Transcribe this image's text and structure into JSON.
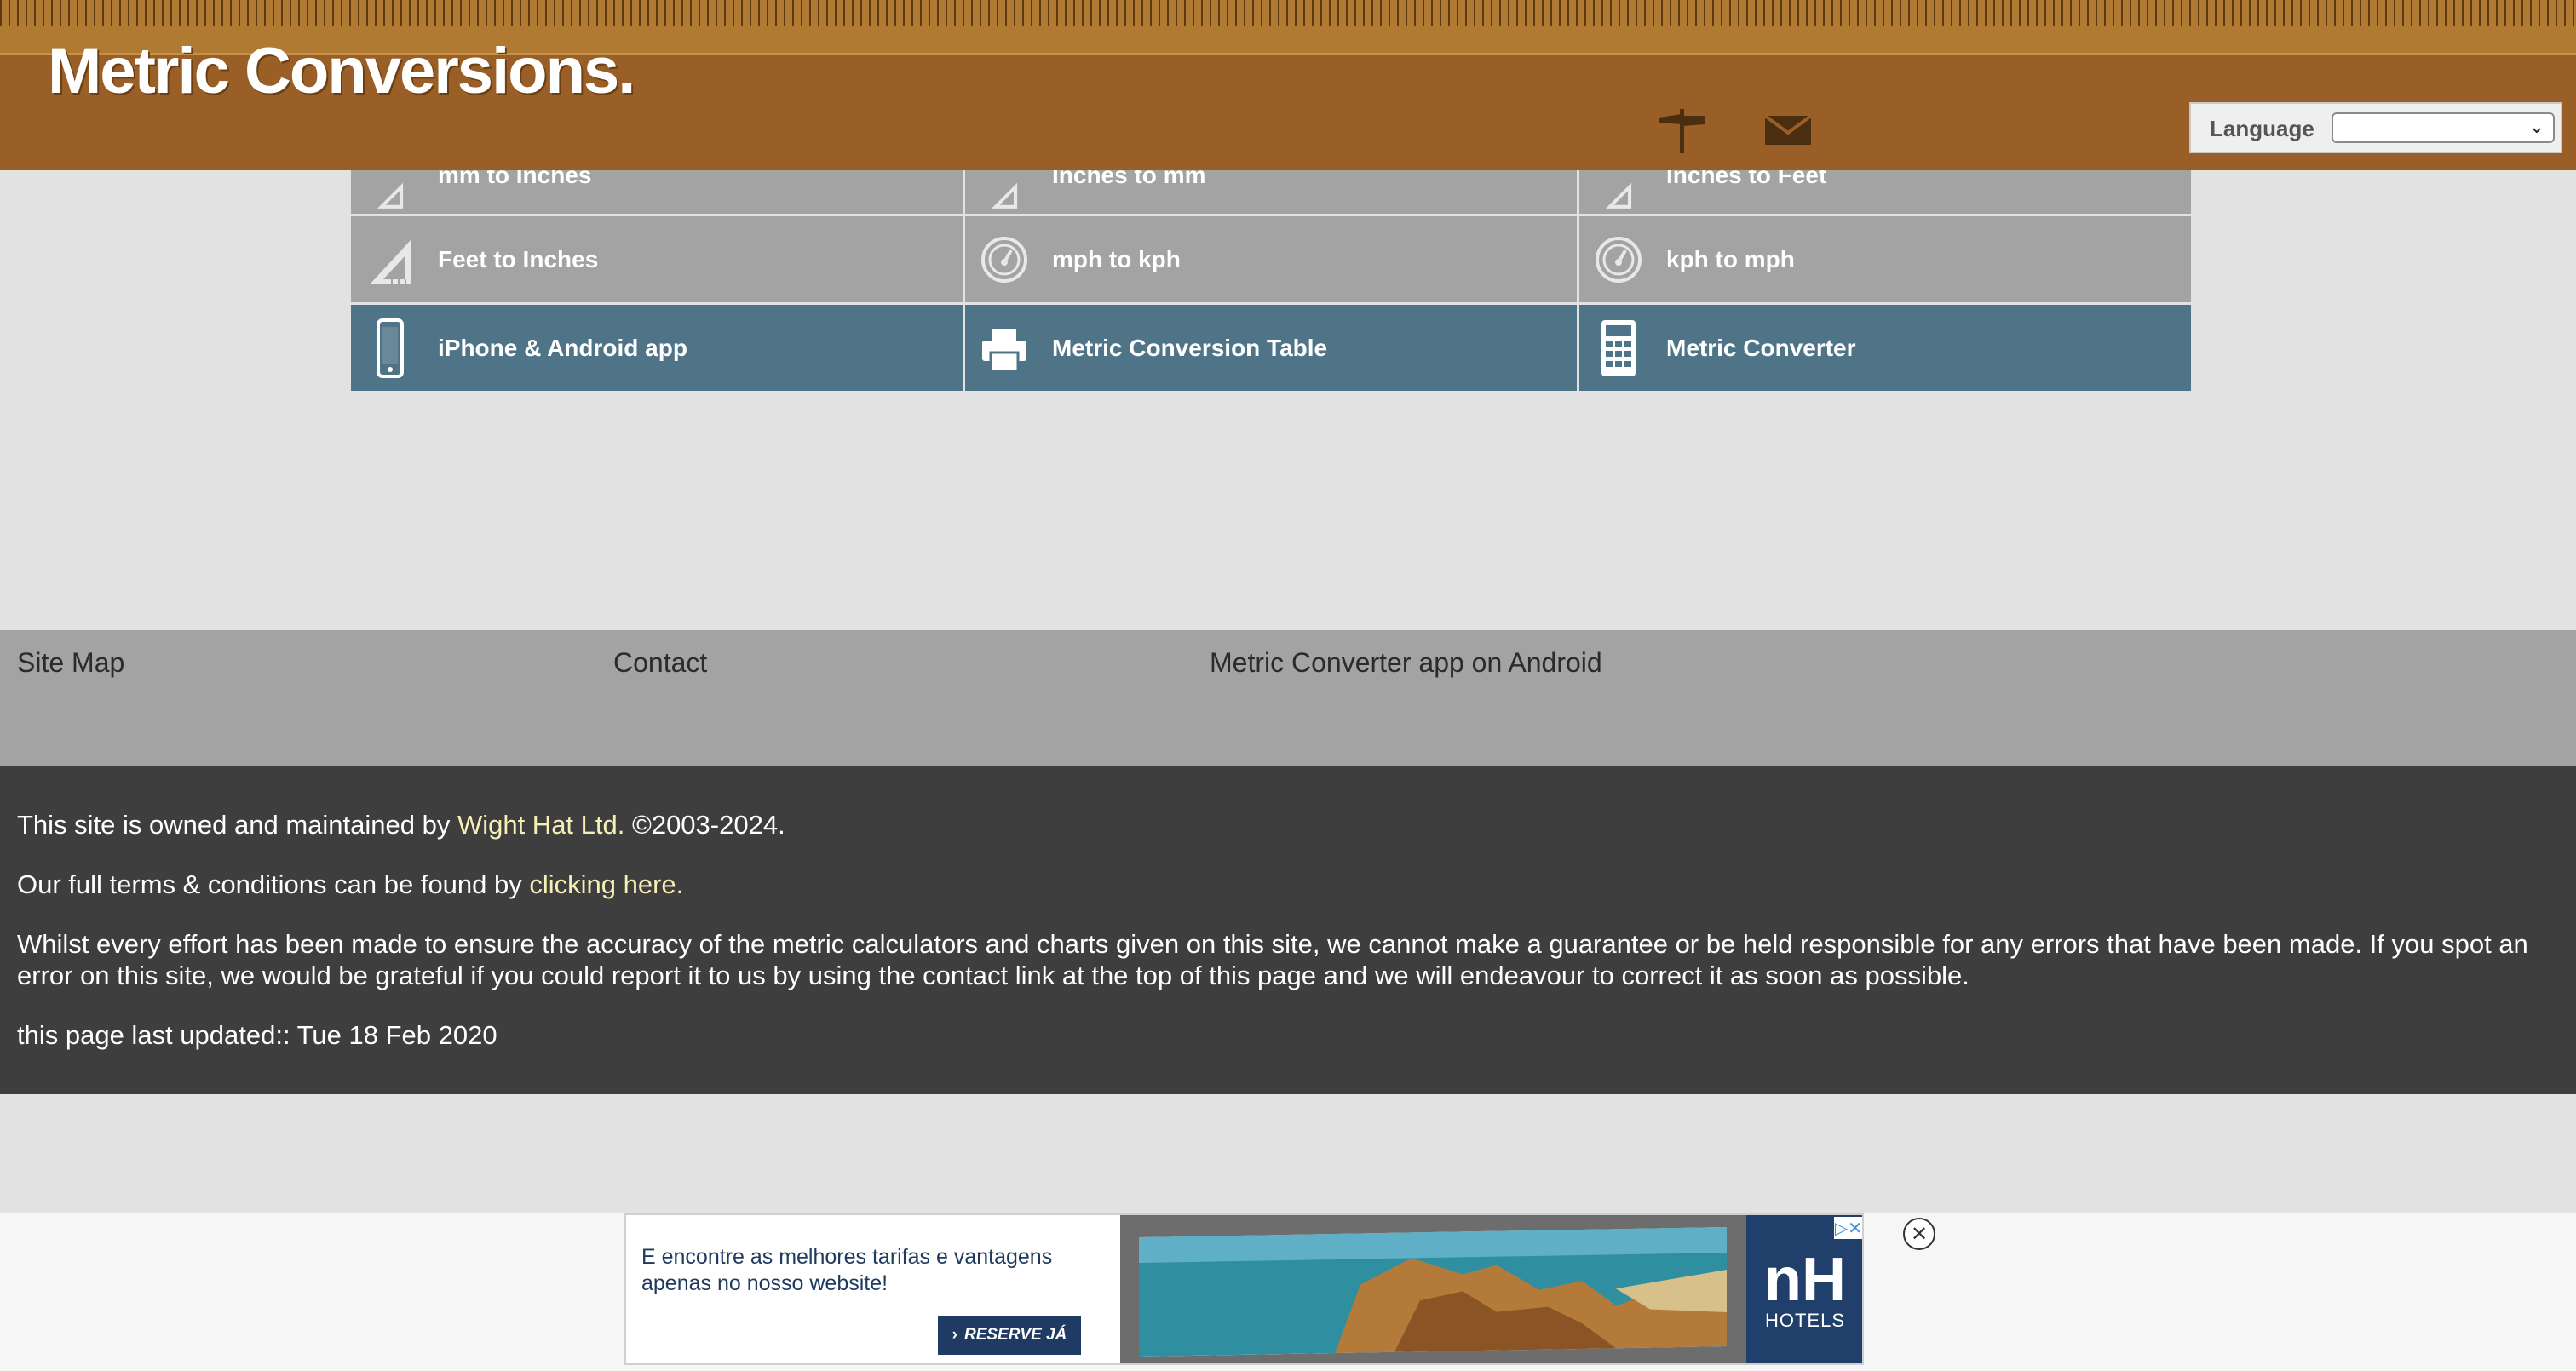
{
  "header": {
    "logo": "Metric Conversions.",
    "icons": [
      "signpost-icon",
      "mail-icon"
    ],
    "language_label": "Language",
    "language_selected": ""
  },
  "tiles": [
    {
      "label": "mm to Inches",
      "icon": "ruler-triangle-icon",
      "style": "grey"
    },
    {
      "label": "Inches to mm",
      "icon": "ruler-triangle-icon",
      "style": "grey"
    },
    {
      "label": "Inches to Feet",
      "icon": "ruler-triangle-icon",
      "style": "grey"
    },
    {
      "label": "Feet to Inches",
      "icon": "ruler-triangle-icon",
      "style": "grey"
    },
    {
      "label": "mph to kph",
      "icon": "speedometer-icon",
      "style": "grey"
    },
    {
      "label": "kph to mph",
      "icon": "speedometer-icon",
      "style": "grey"
    },
    {
      "label": "iPhone & Android app",
      "icon": "phone-icon",
      "style": "blue"
    },
    {
      "label": "Metric Conversion Table",
      "icon": "printer-icon",
      "style": "blue"
    },
    {
      "label": "Metric Converter",
      "icon": "calculator-icon",
      "style": "blue"
    }
  ],
  "footer_nav": {
    "site_map": "Site Map",
    "contact": "Contact",
    "android": "Metric Converter app on Android"
  },
  "info": {
    "owned_pre": "This site is owned and maintained by ",
    "owned_link": "Wight Hat Ltd.",
    "owned_post": " ©2003-2024.",
    "terms_pre": "Our full terms & conditions can be found by ",
    "terms_link": "clicking here.",
    "disclaimer": "Whilst every effort has been made to ensure the accuracy of the metric calculators and charts given on this site, we cannot make a guarantee or be held responsible for any errors that have been made. If you spot an error on this site, we would be grateful if you could report it to us by using the contact link at the top of this page and we will endeavour to correct it as soon as possible.",
    "updated": "this page last updated:: Tue 18 Feb 2020"
  },
  "ad": {
    "text": "E encontre as melhores tarifas e vantagens apenas no nosso website!",
    "button": "RESERVE JÁ",
    "brand": "nH",
    "brand_sub": "HOTELS"
  },
  "colors": {
    "header": "#9a5f27",
    "tile_grey": "#a3a3a3",
    "tile_blue": "#4f7488",
    "footer_dark": "#3f3e3f",
    "link_yellow": "#f6efb6"
  }
}
